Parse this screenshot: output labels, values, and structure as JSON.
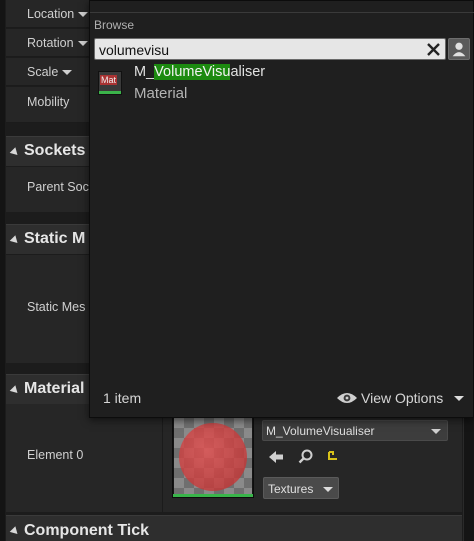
{
  "details": {
    "transform": {
      "location_label": "Location",
      "rotation_label": "Rotation",
      "scale_label": "Scale",
      "mobility_label": "Mobility"
    },
    "sockets": {
      "title": "Sockets",
      "parent_socket_label": "Parent Soc"
    },
    "static_mesh": {
      "title": "Static M",
      "static_mesh_label": "Static Mes"
    },
    "materials": {
      "title": "Material",
      "element_label": "Element 0",
      "asset_value": "M_VolumeVisualiser",
      "textures_label": "Textures"
    },
    "component_tick": {
      "title": "Component Tick"
    }
  },
  "browse_popup": {
    "label": "Browse",
    "search_value": "volumevisu",
    "results": [
      {
        "name_prefix": "M_",
        "name_match": "VolumeVisu",
        "name_suffix": "aliser",
        "type": "Material",
        "icon_abbr": "Mat"
      }
    ],
    "item_count": "1 item",
    "view_options_label": "View Options"
  },
  "colors": {
    "highlight": "#1c8a10",
    "thumb_bar": "#39b54a"
  },
  "icons": [
    "chevron-down-icon",
    "clear-icon",
    "user-icon",
    "material-icon",
    "eye-icon",
    "back-arrow-icon",
    "search-icon",
    "reset-icon"
  ]
}
